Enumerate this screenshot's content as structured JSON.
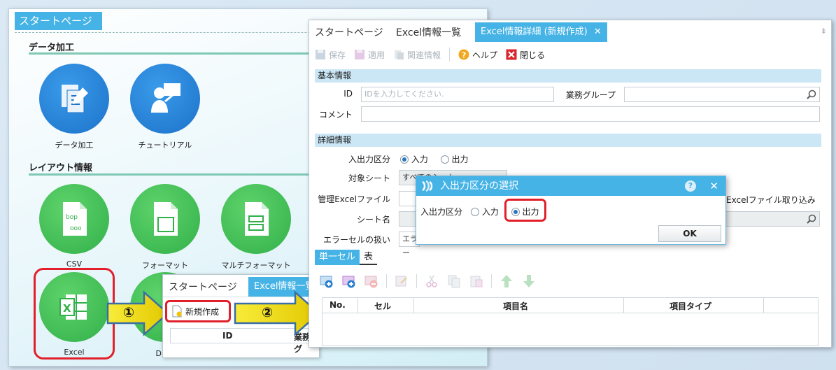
{
  "start_page": {
    "tab_label": "スタートページ",
    "section_data": "データ加工",
    "section_layout": "レイアウト情報",
    "icons": [
      {
        "label": "データ加工"
      },
      {
        "label": "チュートリアル"
      },
      {
        "label": "CSV"
      },
      {
        "label": "フォーマット"
      },
      {
        "label": "マルチフォーマット"
      },
      {
        "label": "Excel"
      },
      {
        "label": "DBテ"
      }
    ]
  },
  "arrows": {
    "step1": "①",
    "step2": "②"
  },
  "mid_window": {
    "tab_start": "スタートページ",
    "tab_excel_list": "Excel情報一覧",
    "new_button": "新規作成",
    "columns": [
      "ID",
      "業務グ"
    ]
  },
  "main_window": {
    "tab_start": "スタートページ",
    "tab_list": "Excel情報一覧",
    "tab_detail": "Excel情報詳細 (新規作成)",
    "tab_close": "✕",
    "pin": "⇟",
    "toolbar": {
      "save": "保存",
      "apply": "適用",
      "related": "関連情報",
      "help": "ヘルプ",
      "close": "閉じる"
    },
    "basic_section": "基本情報",
    "id_label": "ID",
    "id_placeholder": "IDを入力してください.",
    "group_label": "業務グループ",
    "comment_label": "コメント",
    "detail_section": "詳細情報",
    "io_label": "入出力区分",
    "io_in": "入力",
    "io_out": "出力",
    "target_sheet_label": "対象シート",
    "target_sheet_value": "すべてのシート",
    "managed_file_label": "管理Excelファイル",
    "import_label": "Excelファイル取り込み",
    "sheet_name_label": "シート名",
    "error_cell_label": "エラーセルの扱い",
    "error_cell_value": "エラー",
    "subtab_single": "単一セル",
    "subtab_table": "表",
    "grid_columns": [
      "No.",
      "セル",
      "項目名",
      "項目タイプ"
    ]
  },
  "dialog": {
    "title": "入出力区分の選択",
    "help": "?",
    "close": "✕",
    "field_label": "入出力区分",
    "option_in": "入力",
    "option_out": "出力",
    "ok": "OK"
  }
}
